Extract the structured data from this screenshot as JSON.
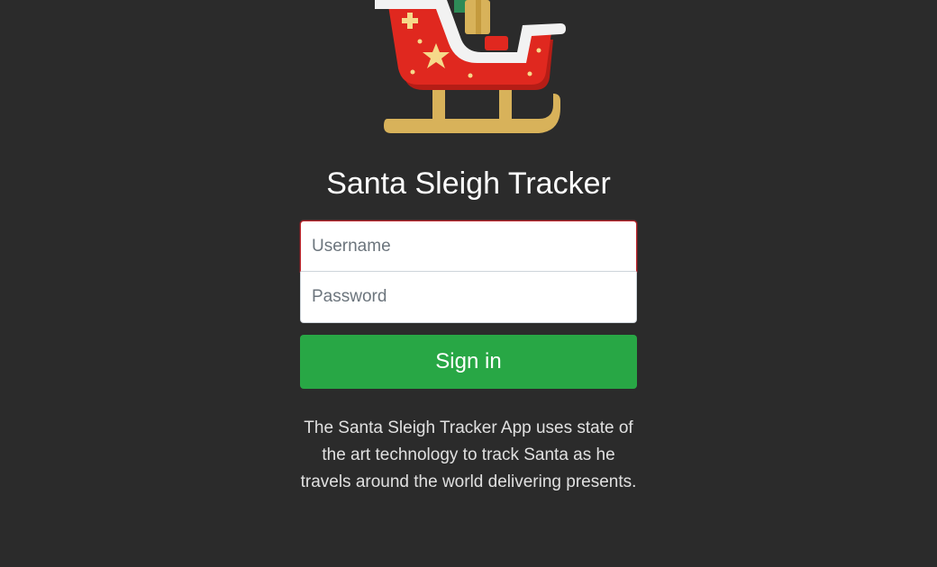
{
  "app": {
    "title": "Santa Sleigh Tracker",
    "logo_icon": "sleigh-icon"
  },
  "login_form": {
    "username_placeholder": "Username",
    "password_placeholder": "Password",
    "username_value": "",
    "password_value": "",
    "submit_label": "Sign in"
  },
  "description": "The Santa Sleigh Tracker App uses state of the art technology to track Santa as he travels around the world delivering presents.",
  "colors": {
    "background": "#2b2b2b",
    "primary_button": "#28a745",
    "focus_border": "#c0262d",
    "sleigh_red": "#e0281f",
    "runner_gold": "#d8b25a"
  }
}
